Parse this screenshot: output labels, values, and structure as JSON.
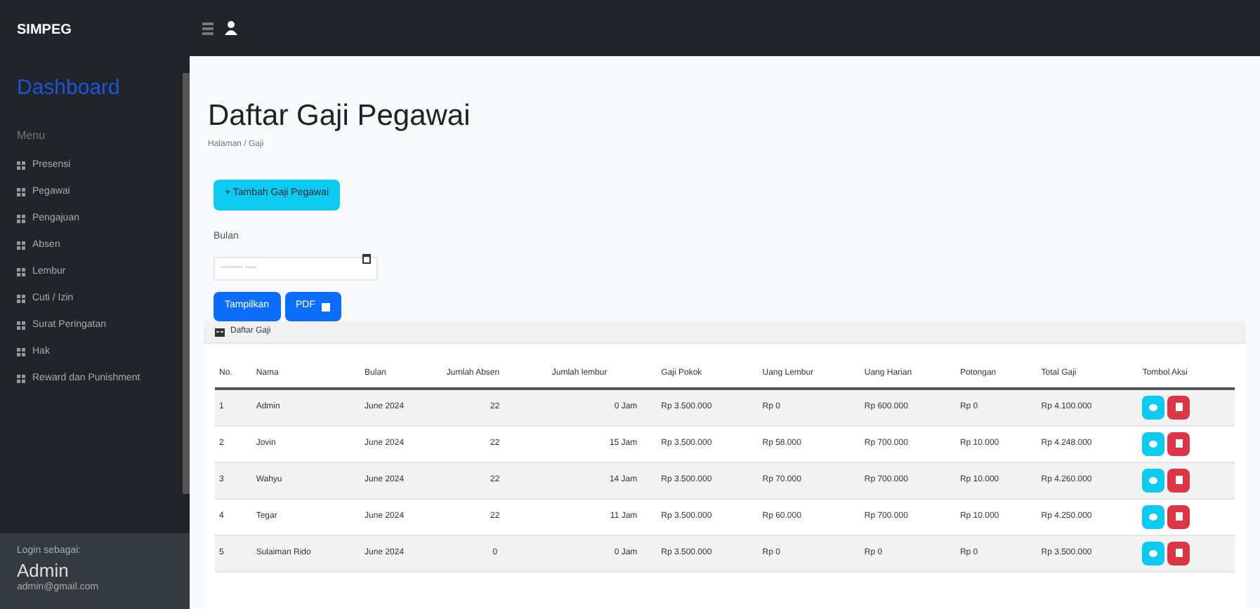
{
  "brand": "SIMPEG",
  "sidebar": {
    "dashboard": "Dashboard",
    "heading": "Menu",
    "items": [
      {
        "label": "Presensi"
      },
      {
        "label": "Pegawai"
      },
      {
        "label": "Pengajuan"
      },
      {
        "label": "Absen"
      },
      {
        "label": "Lembur"
      },
      {
        "label": "Cuti / Izin"
      },
      {
        "label": "Surat Peringatan"
      },
      {
        "label": "Hak"
      },
      {
        "label": "Reward dan Punishment"
      }
    ],
    "footer": {
      "caption": "Login sebagai:",
      "user": "Admin",
      "email": "admin@gmail.com"
    }
  },
  "page": {
    "title": "Daftar Gaji Pegawai",
    "breadcrumb": "Halaman / Gaji",
    "add_button": "+ Tambah Gaji Pegawai",
    "month_label": "Bulan",
    "month_placeholder": "-------- ----",
    "show_button": "Tampilkan",
    "pdf_button": "PDF",
    "card_title": "Daftar Gaji"
  },
  "table": {
    "columns": [
      "No.",
      "Nama",
      "Bulan",
      "Jumlah Absen",
      "Jumlah lembur",
      "Gaji Pokok",
      "Uang Lembur",
      "Uang Harian",
      "Potongan",
      "Total Gaji",
      "Tombol Aksi"
    ],
    "rows": [
      [
        "1",
        "Admin",
        "June 2024",
        "22",
        "0 Jam",
        "Rp 3.500.000",
        "Rp 0",
        "Rp 600.000",
        "Rp 0",
        "Rp 4.100.000"
      ],
      [
        "2",
        "Jovin",
        "June 2024",
        "22",
        "15 Jam",
        "Rp 3.500.000",
        "Rp 58.000",
        "Rp 700.000",
        "Rp 10.000",
        "Rp 4.248.000"
      ],
      [
        "3",
        "Wahyu",
        "June 2024",
        "22",
        "14 Jam",
        "Rp 3.500.000",
        "Rp 70.000",
        "Rp 700.000",
        "Rp 10.000",
        "Rp 4.260.000"
      ],
      [
        "4",
        "Tegar",
        "June 2024",
        "22",
        "11 Jam",
        "Rp 3.500.000",
        "Rp 60.000",
        "Rp 700.000",
        "Rp 10.000",
        "Rp 4.250.000"
      ],
      [
        "5",
        "Sulaiman Rido",
        "June 2024",
        "0",
        "0 Jam",
        "Rp 3.500.000",
        "Rp 0",
        "Rp 0",
        "Rp 0",
        "Rp 3.500.000"
      ]
    ]
  }
}
